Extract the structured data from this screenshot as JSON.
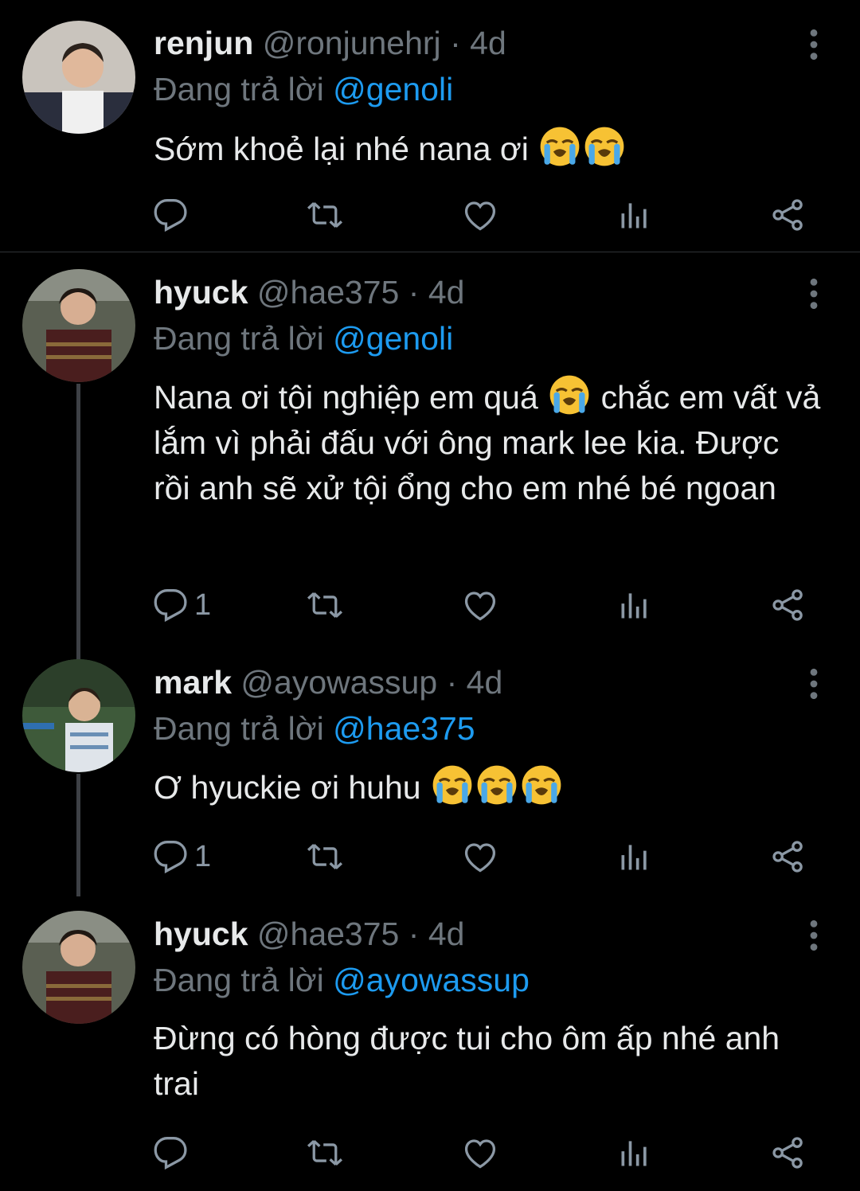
{
  "tweets": [
    {
      "name": "renjun",
      "handle": "@ronjunehrj",
      "sep": "·",
      "time": "4d",
      "replying_label": "Đang trả lời",
      "replying_to": "@genoli",
      "text": "Sớm khoẻ lại nhé nana ơi",
      "emoji": [
        "loudly-crying-face",
        "loudly-crying-face"
      ],
      "reply_count": ""
    },
    {
      "name": "hyuck",
      "handle": "@hae375",
      "sep": "·",
      "time": "4d",
      "replying_label": "Đang trả lời",
      "replying_to": "@genoli",
      "text_before": "Nana ơi tội nghiệp em quá",
      "text_after": "chắc em vất vả lắm vì phải đấu với ông mark lee kia. Được rồi anh sẽ xử tội ổng cho em nhé bé ngoan",
      "emoji": [
        "loudly-crying-face"
      ],
      "reply_count": "1"
    },
    {
      "name": "mark",
      "handle": "@ayowassup",
      "sep": "·",
      "time": "4d",
      "replying_label": "Đang trả lời",
      "replying_to": "@hae375",
      "text": "Ơ hyuckie ơi huhu",
      "emoji": [
        "loudly-crying-face",
        "loudly-crying-face",
        "loudly-crying-face"
      ],
      "reply_count": "1"
    },
    {
      "name": "hyuck",
      "handle": "@hae375",
      "sep": "·",
      "time": "4d",
      "replying_label": "Đang trả lời",
      "replying_to": "@ayowassup",
      "text": "Đừng có hòng được tui cho ôm ấp nhé anh trai",
      "emoji": [],
      "reply_count": ""
    }
  ],
  "action_icons": [
    "reply-icon",
    "retweet-icon",
    "like-icon",
    "analytics-icon",
    "share-icon"
  ],
  "colors": {
    "background": "#000000",
    "mention": "#1d9bf0",
    "muted": "#6e767d",
    "text": "#e7e9ea"
  }
}
